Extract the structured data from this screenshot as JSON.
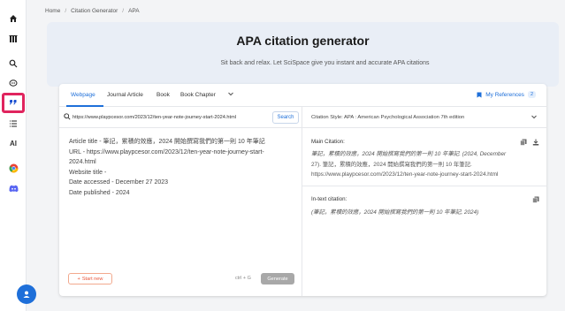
{
  "sidebar": {
    "icons": [
      "home-icon",
      "library-icon",
      "search-icon",
      "chat-icon",
      "quote-icon",
      "list-icon",
      "ai-icon",
      "chrome-icon",
      "discord-icon"
    ]
  },
  "breadcrumb": [
    "Home",
    "Citation Generator",
    "APA"
  ],
  "hero": {
    "title": "APA citation generator",
    "subtitle": "Sit back and relax. Let SciSpace give you instant and accurate APA citations"
  },
  "tabs": [
    {
      "label": "Webpage",
      "active": true
    },
    {
      "label": "Journal Article",
      "active": false
    },
    {
      "label": "Book",
      "active": false
    },
    {
      "label": "Book Chapter",
      "active": false
    }
  ],
  "my_references": {
    "label": "My References",
    "count": "2"
  },
  "search": {
    "value": "https://www.playpcesor.com/2023/12/ten-year-note-journey-start-2024.html",
    "button": "Search"
  },
  "details": [
    "Article title - 筆記，累積的效應，2024 開始撰寫我們的第一則 10 年筆記",
    "URL - https://www.playpcesor.com/2023/12/ten-year-note-journey-start-",
    "2024.html",
    "Website title -",
    "Date accessed - December 27 2023",
    "Date published - 2024"
  ],
  "actions": {
    "start_new": "Start new",
    "shortcut": "ctrl + G",
    "generate": "Generate"
  },
  "citation_style": "Citation Style:  APA : American Psychological Association 7th edition",
  "main_citation": {
    "label": "Main Citation:",
    "lines": [
      "筆記，累積的效應，2024 開始撰寫我們的第一則 10 年筆記. (2024, December",
      "27). 筆記，累積的效應，2024 開始撰寫我們的第一則 10 年筆記.",
      "https://www.playpcesor.com/2023/12/ten-year-note-journey-start-2024.html"
    ]
  },
  "in_text": {
    "label": "In-text citation:",
    "text": "(筆記，累積的效應，2024 開始撰寫我們的第一則 10 年筆記, 2024)"
  },
  "colors": {
    "accent": "#1e6fd9",
    "highlight": "#e0245e",
    "start_new": "#e8553a"
  }
}
